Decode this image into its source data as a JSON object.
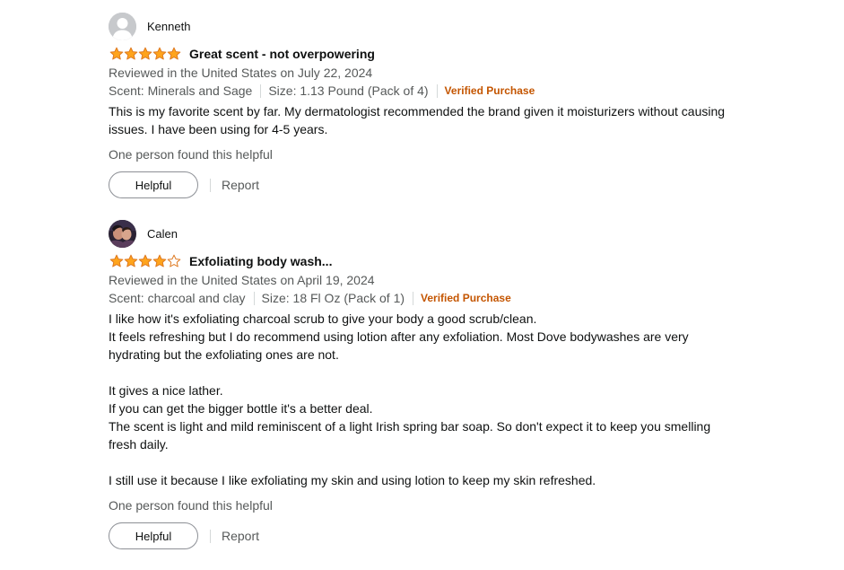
{
  "reviews": [
    {
      "author": "Kenneth",
      "avatar": "default-avatar",
      "rating": 5,
      "max_rating": 5,
      "title": "Great scent - not overpowering",
      "date": "Reviewed in the United States on July 22, 2024",
      "scent": "Scent: Minerals and Sage",
      "size": "Size: 1.13 Pound (Pack of 4)",
      "verified": "Verified Purchase",
      "body": "This is my favorite scent by far. My dermatologist recommended the brand given it moisturizers without causing issues. I have been using for 4-5 years.",
      "helpful_count": "One person found this helpful",
      "helpful_label": "Helpful",
      "report_label": "Report"
    },
    {
      "author": "Calen",
      "avatar": "user-photo-avatar",
      "rating": 4,
      "max_rating": 5,
      "title": "Exfoliating body wash...",
      "date": "Reviewed in the United States on April 19, 2024",
      "scent": "Scent: charcoal and clay",
      "size": "Size: 18 Fl Oz (Pack of 1)",
      "verified": "Verified Purchase",
      "body": "I like how it's exfoliating charcoal scrub to give your body a good scrub/clean.\nIt feels refreshing but I do recommend using lotion after any exfoliation. Most Dove bodywashes are very hydrating but the exfoliating ones are not.\n\nIt gives a nice lather.\nIf you can get the bigger bottle it's a better deal.\nThe scent is light and mild reminiscent of a light Irish spring bar soap. So don't expect it to keep you smelling fresh daily.\n\nI still use it because I like exfoliating my skin and using lotion to keep my skin refreshed.",
      "helpful_count": "One person found this helpful",
      "helpful_label": "Helpful",
      "report_label": "Report"
    }
  ],
  "colors": {
    "star_fill": "#ffa41c",
    "star_stroke": "#de7921",
    "verified": "#c45500",
    "secondary_text": "#565959"
  }
}
